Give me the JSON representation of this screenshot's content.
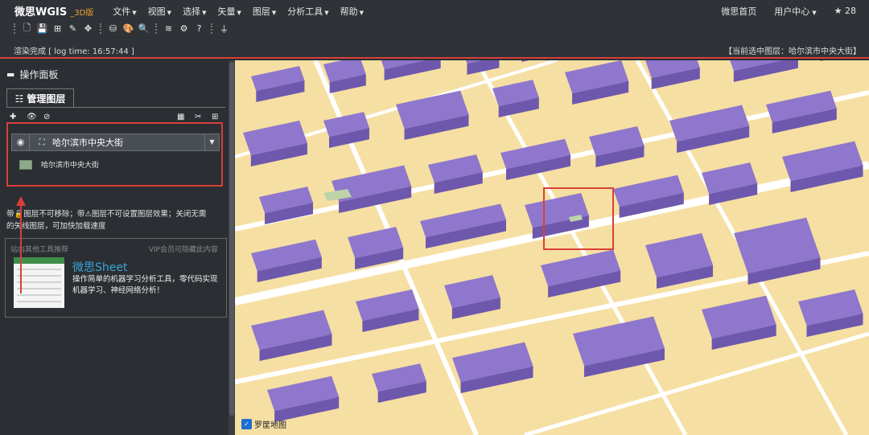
{
  "app": {
    "brand": "微思WGIS",
    "version_tag": "_3D版",
    "menus": [
      "文件",
      "视图",
      "选择",
      "矢量",
      "图层",
      "分析工具",
      "帮助"
    ],
    "home": "微思首页",
    "user_center": "用户中心",
    "stars": "28"
  },
  "toolbar": {
    "groups": [
      [
        "file-new-icon",
        "save-icon",
        "add-icon",
        "edit-icon",
        "move-icon"
      ],
      [
        "layer-group-icon",
        "palette-icon",
        "search-icon"
      ],
      [
        "layers-icon",
        "gear-icon",
        "help-icon"
      ],
      [
        "plugin-icon"
      ]
    ]
  },
  "status": {
    "render_msg": "渲染完成 [ log time:  16:57:44 ]",
    "current_layer": "【当前选中图层：哈尔滨市中央大街】"
  },
  "panel": {
    "title": "操作面板",
    "tab_label": "管理图层",
    "layer_name": "哈尔滨市中央大街",
    "legend_label": "哈尔滨市中央大街",
    "note_line1": "带🔒图层不可移除；带⚠图层不可设置图层效果；关闭无需",
    "note_line2": "的矢线图层，可加快加载速度",
    "promo_header": "站内其他工具推荐",
    "promo_vip": "VIP会员可隐藏此内容",
    "promo_title": "微思Sheet",
    "promo_desc": "操作简单的机器学习分析工具，零代码实现机器学习、神经网络分析！"
  },
  "map": {
    "logo_text": "罗筐地图",
    "colors": {
      "ground": "#f6dfa2",
      "building_top": "#8e77cc",
      "building_side": "#6e58ad",
      "road": "#ffffff",
      "highlight": "#d9403a"
    }
  }
}
